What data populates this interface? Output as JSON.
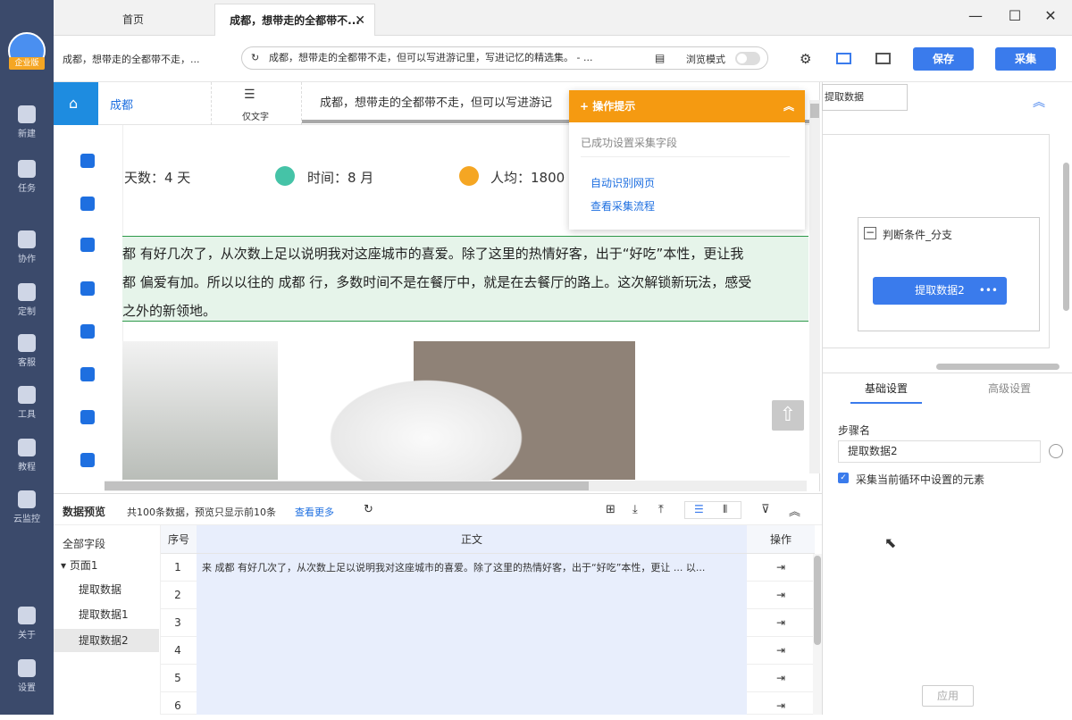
{
  "sidebar": {
    "badge": "企业版",
    "items": [
      "新建",
      "任务",
      "协作",
      "定制",
      "客服",
      "工具",
      "教程",
      "云监控",
      "关于",
      "设置"
    ]
  },
  "tabs": [
    "首页",
    "成都，想带走的全都带不..."
  ],
  "toolbar": {
    "page_title": "成都，想带走的全都带不走，...",
    "url": "成都，想带走的全都带不走，但可以写进游记里，写进记忆的精选集。 - ...",
    "browse_mode": "浏览模式",
    "save": "保存",
    "collect": "采集"
  },
  "browser": {
    "home_label": "成都",
    "textonly": "仅文字",
    "tab_title": "成都，想带走的全都带不走，但可以写进游记",
    "days": "天数：4 天",
    "time": "时间：8 月",
    "avg": "人均：1800",
    "para1": "都 有好几次了，从次数上足以说明我对这座城市的喜爱。除了这里的热情好客，出于“好吃”本性，更让我",
    "para2": "都 偏爱有加。所以以往的 成都 行，多数时间不是在餐厅中，就是在去餐厅的路上。这次解锁新玩法，感受",
    "para3": "之外的新领地。",
    "to_top": "⇧"
  },
  "tips": {
    "title": "操作提示",
    "status": "已成功设置采集字段",
    "link1": "自动识别网页",
    "link2": "查看采集流程"
  },
  "flow": {
    "top_step": "提取数据",
    "condition": "判断条件_分支",
    "step": "提取数据2"
  },
  "settings": {
    "tab_basic": "基础设置",
    "tab_advanced": "高级设置",
    "step_name_label": "步骤名",
    "step_name_value": "提取数据2",
    "checkbox_label": "采集当前循环中设置的元素",
    "apply": "应用"
  },
  "preview": {
    "title": "数据预览",
    "summary": "共100条数据，预览只显示前10条",
    "more": "查看更多",
    "all_fields": "全部字段",
    "page": "页面1",
    "fields": [
      "提取数据",
      "提取数据1",
      "提取数据2"
    ],
    "col_no": "序号",
    "col_text": "正文",
    "col_op": "操作",
    "rows": [
      {
        "n": "1",
        "text": "来 成都 有好几次了，从次数上足以说明我对这座城市的喜爱。除了这里的热情好客，出于“好吃”本性，更让 ... 以..."
      },
      {
        "n": "2",
        "text": ""
      },
      {
        "n": "3",
        "text": ""
      },
      {
        "n": "4",
        "text": ""
      },
      {
        "n": "5",
        "text": ""
      },
      {
        "n": "6",
        "text": ""
      }
    ]
  }
}
